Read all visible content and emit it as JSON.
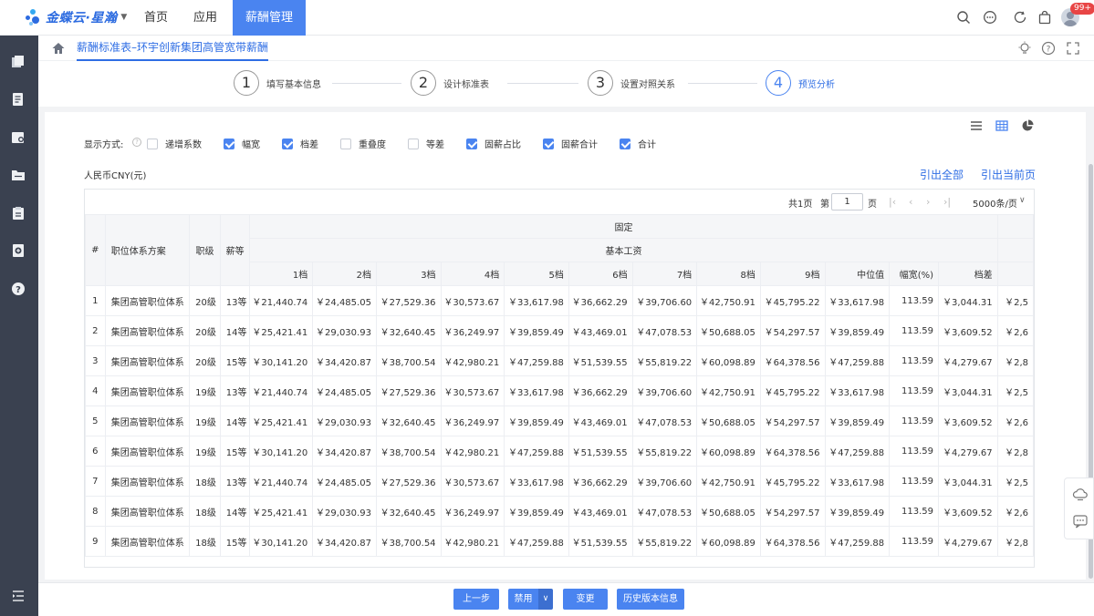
{
  "topbar": {
    "logo_text": "金蝶云·星瀚",
    "nav": [
      "首页",
      "应用",
      "薪酬管理"
    ],
    "badge": "99+"
  },
  "breadcrumb": {
    "tab": "薪酬标准表–环宇创新集团高管宽带薪酬"
  },
  "steps": [
    {
      "num": "1",
      "label": "填写基本信息"
    },
    {
      "num": "2",
      "label": "设计标准表"
    },
    {
      "num": "3",
      "label": "设置对照关系"
    },
    {
      "num": "4",
      "label": "预览分析"
    }
  ],
  "display": {
    "label": "显示方式:",
    "options": [
      {
        "label": "递增系数",
        "checked": false
      },
      {
        "label": "幅宽",
        "checked": true
      },
      {
        "label": "档差",
        "checked": true
      },
      {
        "label": "重叠度",
        "checked": false
      },
      {
        "label": "等差",
        "checked": false
      },
      {
        "label": "固薪占比",
        "checked": true
      },
      {
        "label": "固薪合计",
        "checked": true
      },
      {
        "label": "合计",
        "checked": true
      }
    ]
  },
  "currency": "人民币CNY(元)",
  "links": {
    "export_all": "引出全部",
    "export_page": "引出当前页"
  },
  "pager": {
    "total": "共1页",
    "page_prefix": "第",
    "page_value": "1",
    "page_suffix": "页",
    "page_size": "5000条/页"
  },
  "table": {
    "group1": "固定",
    "group2": "基本工资",
    "fixed_headers": [
      "#",
      "职位体系方案",
      "职级",
      "薪等"
    ],
    "columns": [
      "1档",
      "2档",
      "3档",
      "4档",
      "5档",
      "6档",
      "7档",
      "8档",
      "9档",
      "中位值",
      "幅宽(%)",
      "档差"
    ],
    "rows": [
      [
        "1",
        "集团高管职位体系",
        "20级",
        "13等",
        "￥21,440.74",
        "￥24,485.05",
        "￥27,529.36",
        "￥30,573.67",
        "￥33,617.98",
        "￥36,662.29",
        "￥39,706.60",
        "￥42,750.91",
        "￥45,795.22",
        "￥33,617.98",
        "113.59",
        "￥3,044.31",
        "￥2,5"
      ],
      [
        "2",
        "集团高管职位体系",
        "20级",
        "14等",
        "￥25,421.41",
        "￥29,030.93",
        "￥32,640.45",
        "￥36,249.97",
        "￥39,859.49",
        "￥43,469.01",
        "￥47,078.53",
        "￥50,688.05",
        "￥54,297.57",
        "￥39,859.49",
        "113.59",
        "￥3,609.52",
        "￥2,6"
      ],
      [
        "3",
        "集团高管职位体系",
        "20级",
        "15等",
        "￥30,141.20",
        "￥34,420.87",
        "￥38,700.54",
        "￥42,980.21",
        "￥47,259.88",
        "￥51,539.55",
        "￥55,819.22",
        "￥60,098.89",
        "￥64,378.56",
        "￥47,259.88",
        "113.59",
        "￥4,279.67",
        "￥2,8"
      ],
      [
        "4",
        "集团高管职位体系",
        "19级",
        "13等",
        "￥21,440.74",
        "￥24,485.05",
        "￥27,529.36",
        "￥30,573.67",
        "￥33,617.98",
        "￥36,662.29",
        "￥39,706.60",
        "￥42,750.91",
        "￥45,795.22",
        "￥33,617.98",
        "113.59",
        "￥3,044.31",
        "￥2,5"
      ],
      [
        "5",
        "集团高管职位体系",
        "19级",
        "14等",
        "￥25,421.41",
        "￥29,030.93",
        "￥32,640.45",
        "￥36,249.97",
        "￥39,859.49",
        "￥43,469.01",
        "￥47,078.53",
        "￥50,688.05",
        "￥54,297.57",
        "￥39,859.49",
        "113.59",
        "￥3,609.52",
        "￥2,6"
      ],
      [
        "6",
        "集团高管职位体系",
        "19级",
        "15等",
        "￥30,141.20",
        "￥34,420.87",
        "￥38,700.54",
        "￥42,980.21",
        "￥47,259.88",
        "￥51,539.55",
        "￥55,819.22",
        "￥60,098.89",
        "￥64,378.56",
        "￥47,259.88",
        "113.59",
        "￥4,279.67",
        "￥2,8"
      ],
      [
        "7",
        "集团高管职位体系",
        "18级",
        "13等",
        "￥21,440.74",
        "￥24,485.05",
        "￥27,529.36",
        "￥30,573.67",
        "￥33,617.98",
        "￥36,662.29",
        "￥39,706.60",
        "￥42,750.91",
        "￥45,795.22",
        "￥33,617.98",
        "113.59",
        "￥3,044.31",
        "￥2,5"
      ],
      [
        "8",
        "集团高管职位体系",
        "18级",
        "14等",
        "￥25,421.41",
        "￥29,030.93",
        "￥32,640.45",
        "￥36,249.97",
        "￥39,859.49",
        "￥43,469.01",
        "￥47,078.53",
        "￥50,688.05",
        "￥54,297.57",
        "￥39,859.49",
        "113.59",
        "￥3,609.52",
        "￥2,6"
      ],
      [
        "9",
        "集团高管职位体系",
        "18级",
        "15等",
        "￥30,141.20",
        "￥34,420.87",
        "￥38,700.54",
        "￥42,980.21",
        "￥47,259.88",
        "￥51,539.55",
        "￥55,819.22",
        "￥60,098.89",
        "￥64,378.56",
        "￥47,259.88",
        "113.59",
        "￥4,279.67",
        "￥2,8"
      ]
    ]
  },
  "buttons": {
    "prev": "上一步",
    "disable": "禁用",
    "change": "变更",
    "history": "历史版本信息"
  },
  "colors": {
    "primary": "#4a84f0",
    "link": "#2f6ee4",
    "rail": "#3a4150",
    "badge": "#e84545"
  }
}
